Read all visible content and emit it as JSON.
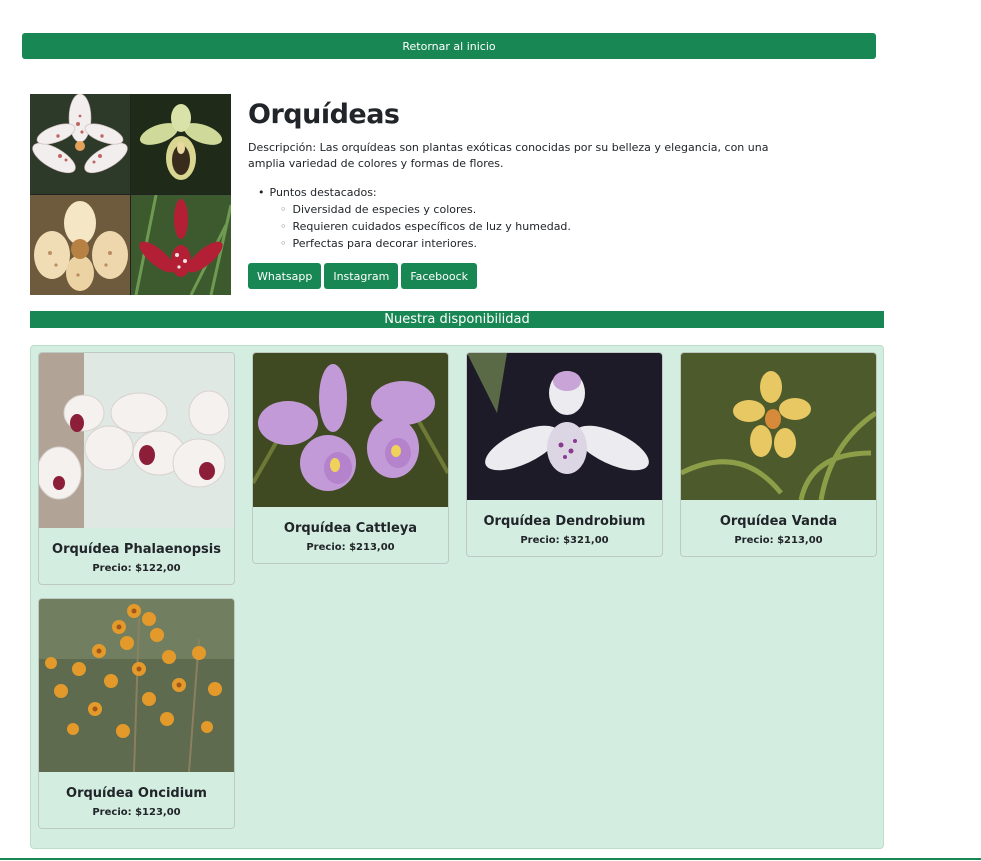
{
  "colors": {
    "accent": "#198754",
    "panel": "#d4ede1"
  },
  "nav": {
    "home_label": "Retornar al inicio"
  },
  "hero": {
    "title": "Orquídeas",
    "description": "Descripción: Las orquídeas son plantas exóticas conocidas por su belleza y elegancia, con una amplia variedad de colores y formas de flores.",
    "highlights_label": "Puntos destacados:",
    "highlights": [
      "Diversidad de especies y colores.",
      "Requieren cuidados específicos de luz y humedad.",
      "Perfectas para decorar interiores."
    ],
    "social": [
      "Whatsapp",
      "Instagram",
      "Faceboock"
    ]
  },
  "catalog": {
    "banner": "Nuestra disponibilidad",
    "products": [
      {
        "name": "Orquídea Phalaenopsis",
        "price": "Precio: $122,00"
      },
      {
        "name": "Orquídea Cattleya",
        "price": "Precio: $213,00"
      },
      {
        "name": "Orquídea Dendrobium",
        "price": "Precio: $321,00"
      },
      {
        "name": "Orquídea Vanda",
        "price": "Precio: $213,00"
      },
      {
        "name": "Orquídea Oncidium",
        "price": "Precio: $123,00"
      }
    ]
  }
}
